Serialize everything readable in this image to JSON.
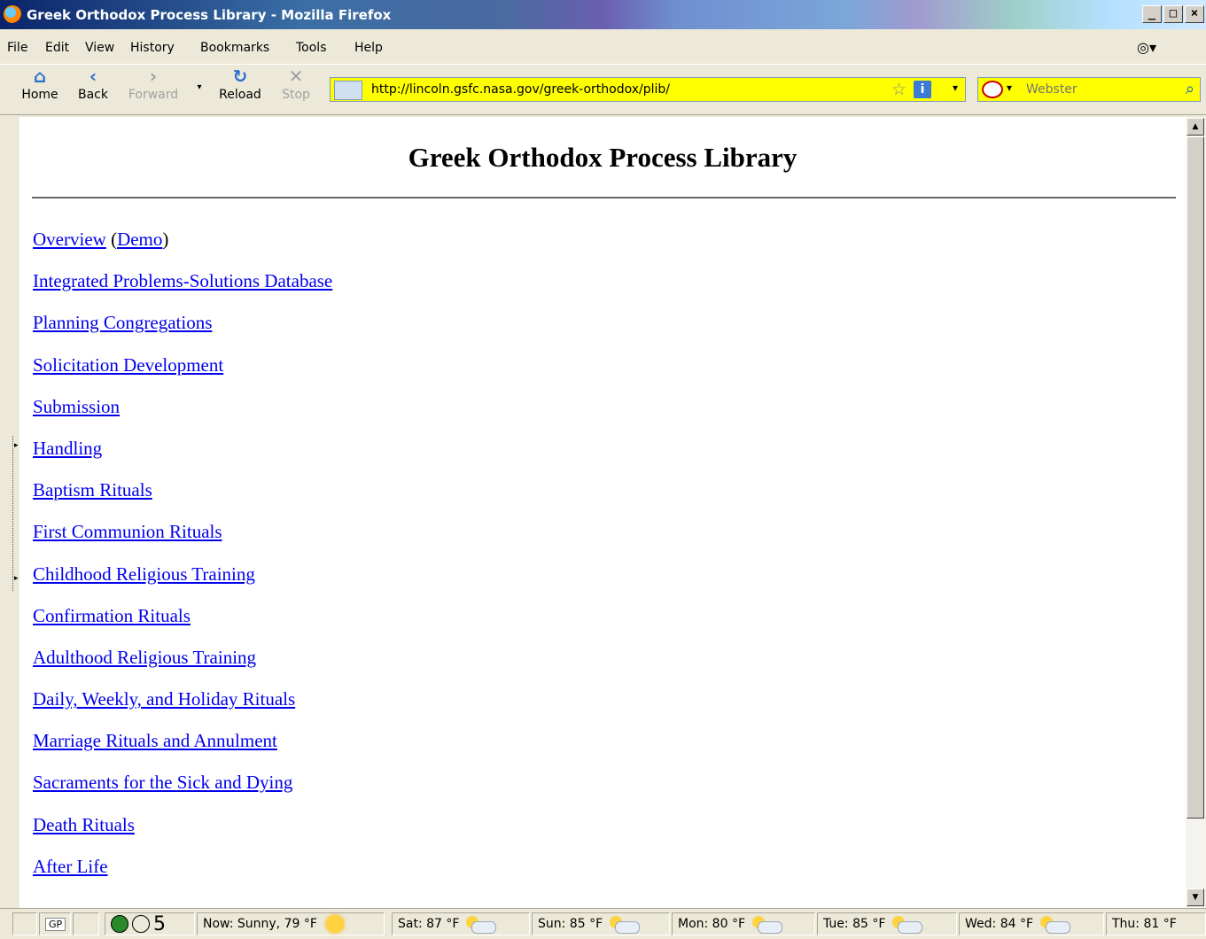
{
  "window": {
    "title": "Greek Orthodox Process Library - Mozilla Firefox"
  },
  "menu": [
    "File",
    "Edit",
    "View",
    "History",
    "Bookmarks",
    "Tools",
    "Help"
  ],
  "toolbar": {
    "home": "Home",
    "back": "Back",
    "forward": "Forward",
    "reload": "Reload",
    "stop": "Stop"
  },
  "address": {
    "url": "http://lincoln.gsfc.nasa.gov/greek-orthodox/plib/"
  },
  "search": {
    "placeholder": "Webster"
  },
  "page": {
    "heading": "Greek Orthodox Process Library",
    "overview": "Overview",
    "demo": "Demo",
    "links": [
      "Integrated Problems-Solutions Database",
      "Planning Congregations",
      "Solicitation Development",
      "Submission",
      "Handling",
      "Baptism Rituals",
      "First Communion Rituals",
      "Childhood Religious Training",
      "Confirmation Rituals",
      "Adulthood Religious Training",
      "Daily, Weekly, and Holiday Rituals",
      "Marriage Rituals and Annulment",
      "Sacraments for the Sick and Dying",
      "Death Rituals",
      "After Life"
    ]
  },
  "status": {
    "gp": "GP",
    "count": "5",
    "now": "Now: Sunny, 79 °F",
    "sat": "Sat: 87 °F",
    "sun": "Sun: 85 °F",
    "mon": "Mon: 80 °F",
    "tue": "Tue: 85 °F",
    "wed": "Wed: 84 °F",
    "thu": "Thu: 81 °F"
  }
}
